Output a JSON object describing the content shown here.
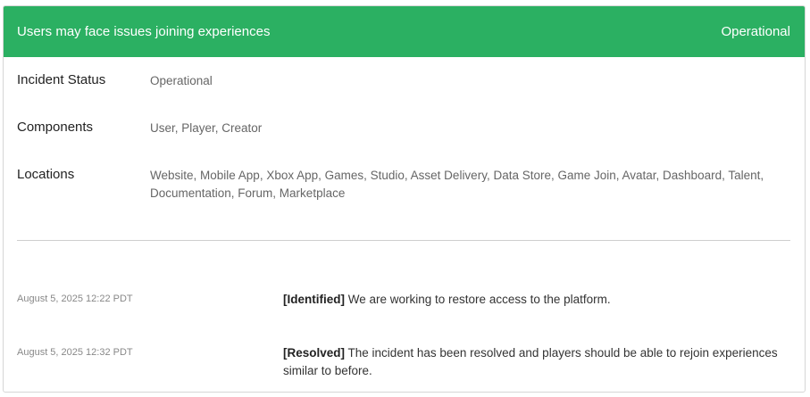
{
  "header": {
    "title": "Users may face issues joining experiences",
    "status": "Operational",
    "color": "#2bb062"
  },
  "details": {
    "incident_status_label": "Incident Status",
    "incident_status_value": "Operational",
    "components_label": "Components",
    "components_value": "User, Player, Creator",
    "locations_label": "Locations",
    "locations_value": "Website, Mobile App, Xbox App, Games, Studio, Asset Delivery, Data Store, Game Join, Avatar, Dashboard, Talent, Documentation, Forum, Marketplace"
  },
  "updates": [
    {
      "time": "August 5, 2025 12:22 PDT",
      "tag": "[Identified]",
      "message": " We are working to restore access to the platform."
    },
    {
      "time": "August 5, 2025 12:32 PDT",
      "tag": "[Resolved]",
      "message": " The incident has been resolved and players should be able to rejoin experiences similar to before."
    }
  ]
}
